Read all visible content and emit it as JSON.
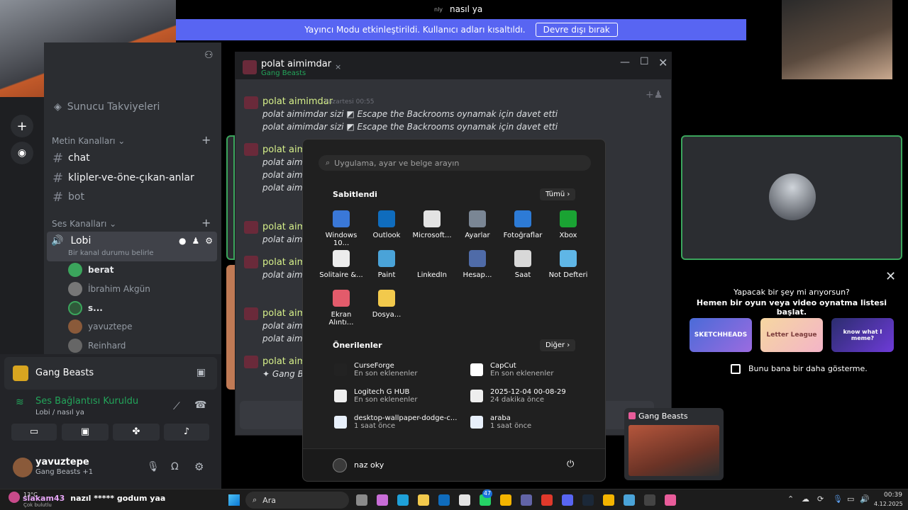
{
  "banner": {
    "message": "Yayıncı Modu etkinleştirildi. Kullanıcı adları kısaltıldı.",
    "disable_button": "Devre dışı bırak"
  },
  "now_playing_title": "nasıl ya",
  "channels": {
    "server_boosts": "Sunucu Takviyeleri",
    "text_section": "Metin Kanalları",
    "text": [
      "chat",
      "klipler-ve-öne-çıkan-anlar",
      "bot"
    ],
    "voice_section": "Ses Kanalları",
    "voice_channel": "Lobi",
    "voice_status": "Bir kanal durumu belirle",
    "voice_users": [
      "berat",
      "İbrahim Akgün",
      "s...",
      "yavuztepe",
      "Reinhard"
    ]
  },
  "activity": {
    "game": "Gang Beasts",
    "connection": "Ses Bağlantısı Kuruldu",
    "connection_sub": "Lobi / nasıl ya"
  },
  "user": {
    "name": "yavuztepe",
    "status": "Gang Beasts +1"
  },
  "chat": {
    "title": "polat aimimdar",
    "subtitle": "Gang Beasts",
    "author": "polat aimimdar",
    "timestamp": "Pazartesi 00:55",
    "lines": [
      "polat aimimdar sizi",
      "Escape the Backrooms oynamak için davet etti"
    ],
    "truncated_author": "polat aim",
    "truncated_line": "polat aim",
    "last_line": "Gang B"
  },
  "start_menu": {
    "search_placeholder": "Uygulama, ayar ve belge arayın",
    "pinned_title": "Sabitlendi",
    "all_button": "Tümü",
    "pinned_apps": [
      {
        "label": "Windows 10...",
        "icon": "windows-icon",
        "color": "#3a78d8"
      },
      {
        "label": "Outlook",
        "icon": "outlook-icon",
        "color": "#0f6cbd"
      },
      {
        "label": "Microsoft...",
        "icon": "store-icon",
        "color": "#e3e3e3"
      },
      {
        "label": "Ayarlar",
        "icon": "gear-icon",
        "color": "#7a8694"
      },
      {
        "label": "Fotoğraflar",
        "icon": "photos-icon",
        "color": "#2d7bd6"
      },
      {
        "label": "Xbox",
        "icon": "xbox-icon",
        "color": "#1aa333"
      },
      {
        "label": "Solitaire &...",
        "icon": "cards-icon",
        "color": "#ececec"
      },
      {
        "label": "Paint",
        "icon": "paint-icon",
        "color": "#4aa3d8"
      },
      {
        "label": "LinkedIn",
        "icon": "linkedin-icon",
        "color": "#202020"
      },
      {
        "label": "Hesap...",
        "icon": "calculator-icon",
        "color": "#4f6ba8"
      },
      {
        "label": "Saat",
        "icon": "clock-icon",
        "color": "#d8d8d8"
      },
      {
        "label": "Not Defteri",
        "icon": "notepad-icon",
        "color": "#5fb6e6"
      },
      {
        "label": "Ekran Alıntı...",
        "icon": "snip-icon",
        "color": "#e35b6b"
      },
      {
        "label": "Dosya...",
        "icon": "folder-icon",
        "color": "#f2c94c"
      }
    ],
    "recommended_title": "Önerilenler",
    "more_button": "Diğer",
    "recommended": [
      {
        "name": "CurseForge",
        "sub": "En son eklenenler",
        "icon": "curseforge-icon",
        "color": "#222"
      },
      {
        "name": "CapCut",
        "sub": "En son eklenenler",
        "icon": "capcut-icon",
        "color": "#fff"
      },
      {
        "name": "Logitech G HUB",
        "sub": "En son eklenenler",
        "icon": "logitech-icon",
        "color": "#eee"
      },
      {
        "name": "2025-12-04 00-08-29",
        "sub": "24 dakika önce",
        "icon": "video-file-icon",
        "color": "#eee"
      },
      {
        "name": "desktop-wallpaper-dodge-c...",
        "sub": "1 saat önce",
        "icon": "image-file-icon",
        "color": "#e8f0fb"
      },
      {
        "name": "araba",
        "sub": "1 saat önce",
        "icon": "image-file-icon",
        "color": "#e8f0fb"
      }
    ],
    "user_name": "naz oky"
  },
  "right_panel": {
    "prompt_title": "Yapacak bir şey mi arıyorsun?",
    "prompt_sub": "Hemen bir oyun veya video oynatma listesi başlat.",
    "dont_show": "Bunu bana bir daha gösterme.",
    "game_cards": [
      "SKETCHHEADS",
      "Letter League",
      "know what I meme?"
    ]
  },
  "preview": {
    "title": "Gang Beasts"
  },
  "taskbar": {
    "weather": "13°C",
    "weather_sub": "Çok bulutlu",
    "search": "Ara",
    "time": "00:39",
    "date": "4.12.2025",
    "badge_count": "47"
  },
  "stream_chat": {
    "user": "siakam43",
    "text": "nazıl ***** godum yaa"
  }
}
